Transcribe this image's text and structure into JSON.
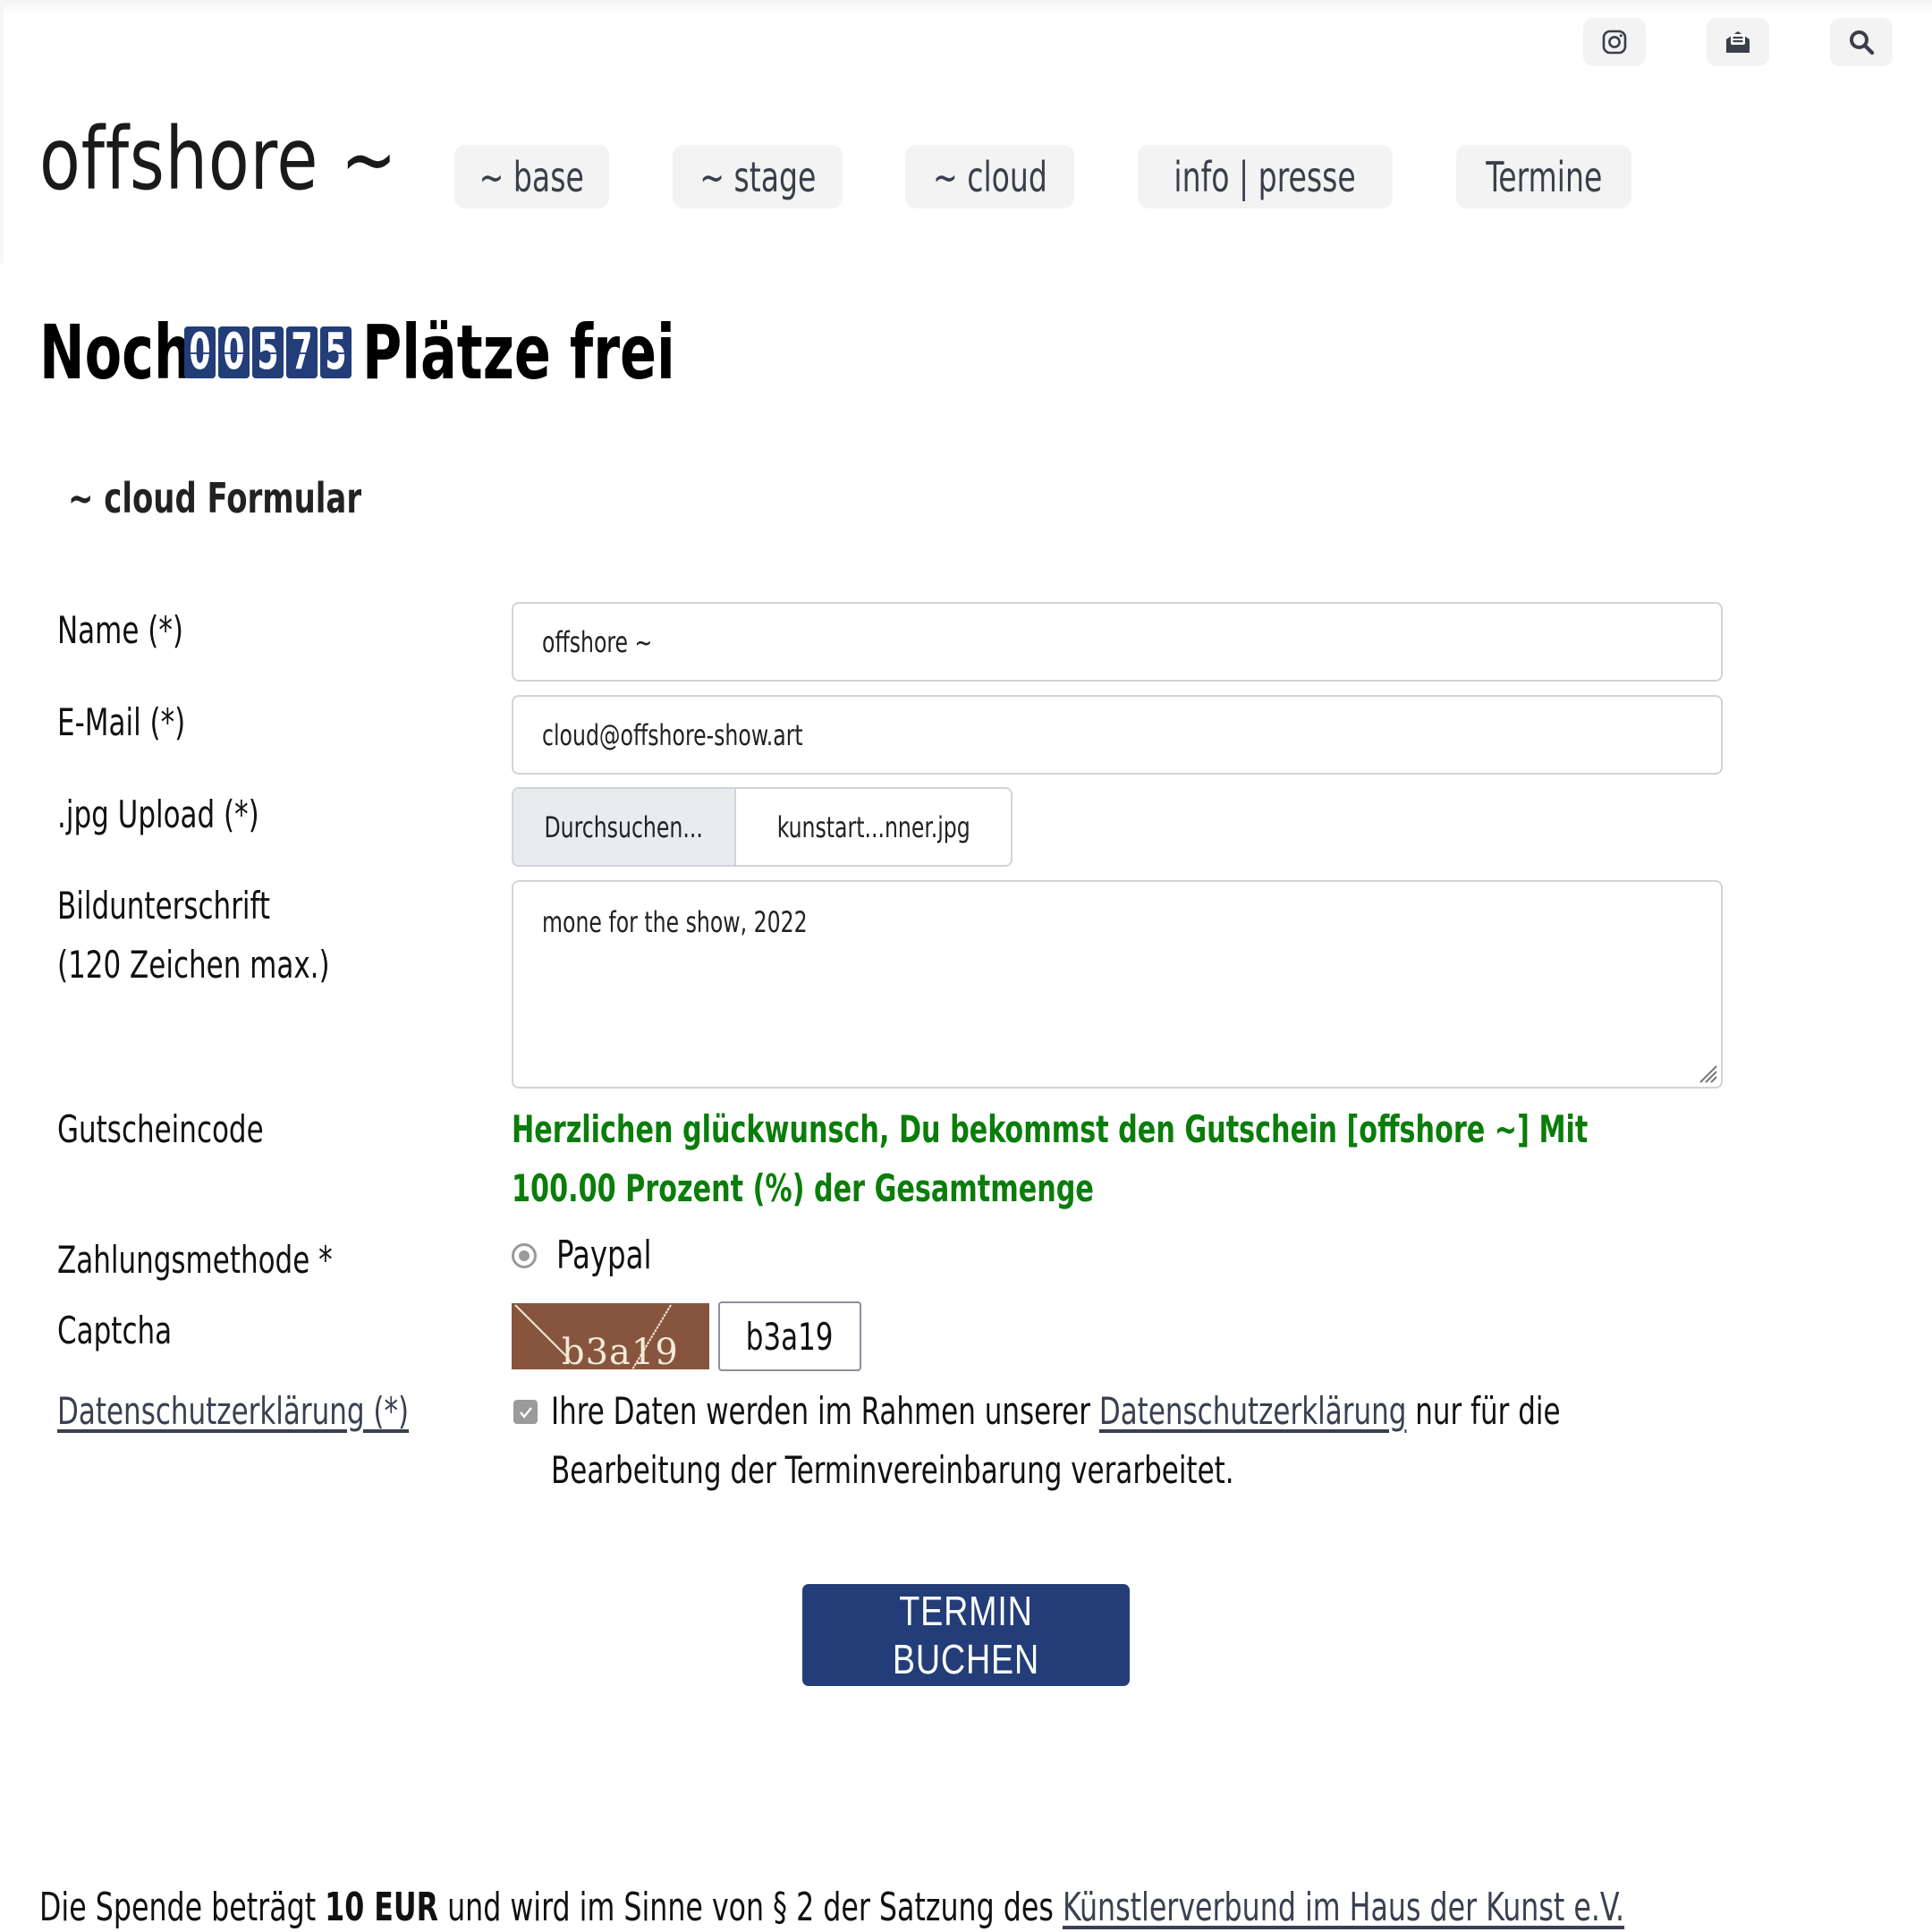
{
  "header": {
    "logo": "offshore ~",
    "top_icons": [
      {
        "name": "instagram-icon",
        "label": "Instagram"
      },
      {
        "name": "envelope-open-text-icon",
        "label": "Newsletter"
      },
      {
        "name": "search-icon",
        "label": "Suche"
      }
    ],
    "nav": [
      {
        "label": "~ base"
      },
      {
        "label": "~ stage"
      },
      {
        "label": "~ cloud"
      },
      {
        "label": "info | presse"
      },
      {
        "label": "Termine"
      }
    ]
  },
  "availability": {
    "prefix": "Noch",
    "digits": [
      "0",
      "0",
      "5",
      "7",
      "5"
    ],
    "count": "00575",
    "suffix": "Plätze frei"
  },
  "form": {
    "section_title": "~ cloud Formular",
    "name": {
      "label": "Name (*)",
      "value": "offshore ~"
    },
    "email": {
      "label": "E-Mail (*)",
      "value": "cloud@offshore-show.art"
    },
    "upload": {
      "label": ".jpg Upload (*)",
      "button": "Durchsuchen...",
      "filename": "kunstart...nner.jpg"
    },
    "caption": {
      "label_line1": "Bildunterschrift",
      "label_line2": "(120 Zeichen max.)",
      "value": "mone for the show, 2022"
    },
    "voucher": {
      "label": "Gutscheincode",
      "message_line1": "Herzlichen glückwunsch, Du bekommst den Gutschein [offshore ~] Mit",
      "message_line2": "100.00 Prozent (%) der Gesamtmenge",
      "color": "#0a7d0a"
    },
    "payment": {
      "label": "Zahlungsmethode *",
      "option": "Paypal",
      "selected": true
    },
    "captcha": {
      "label": "Captcha",
      "image_text": "b3a19",
      "value": "b3a19"
    },
    "privacy": {
      "label": "Datenschutzerklärung (*)",
      "checked": true,
      "text_before": "Ihre Daten werden im Rahmen unserer ",
      "link": "Datenschutzerklärung",
      "text_after": " nur für die",
      "line2": "Bearbeitung der Terminvereinbarung verarbeitet."
    },
    "submit": "TERMIN BUCHEN"
  },
  "footer": {
    "text_before": "Die Spende beträgt ",
    "amount": "10 EUR",
    "text_middle": " und wird im Sinne von § 2 der Satzung des ",
    "link": "Künstlerverbund im Haus der Kunst e.V."
  },
  "colors": {
    "accent": "#233d79",
    "success": "#0a7d0a",
    "nav_bg": "#f3f3f3"
  }
}
